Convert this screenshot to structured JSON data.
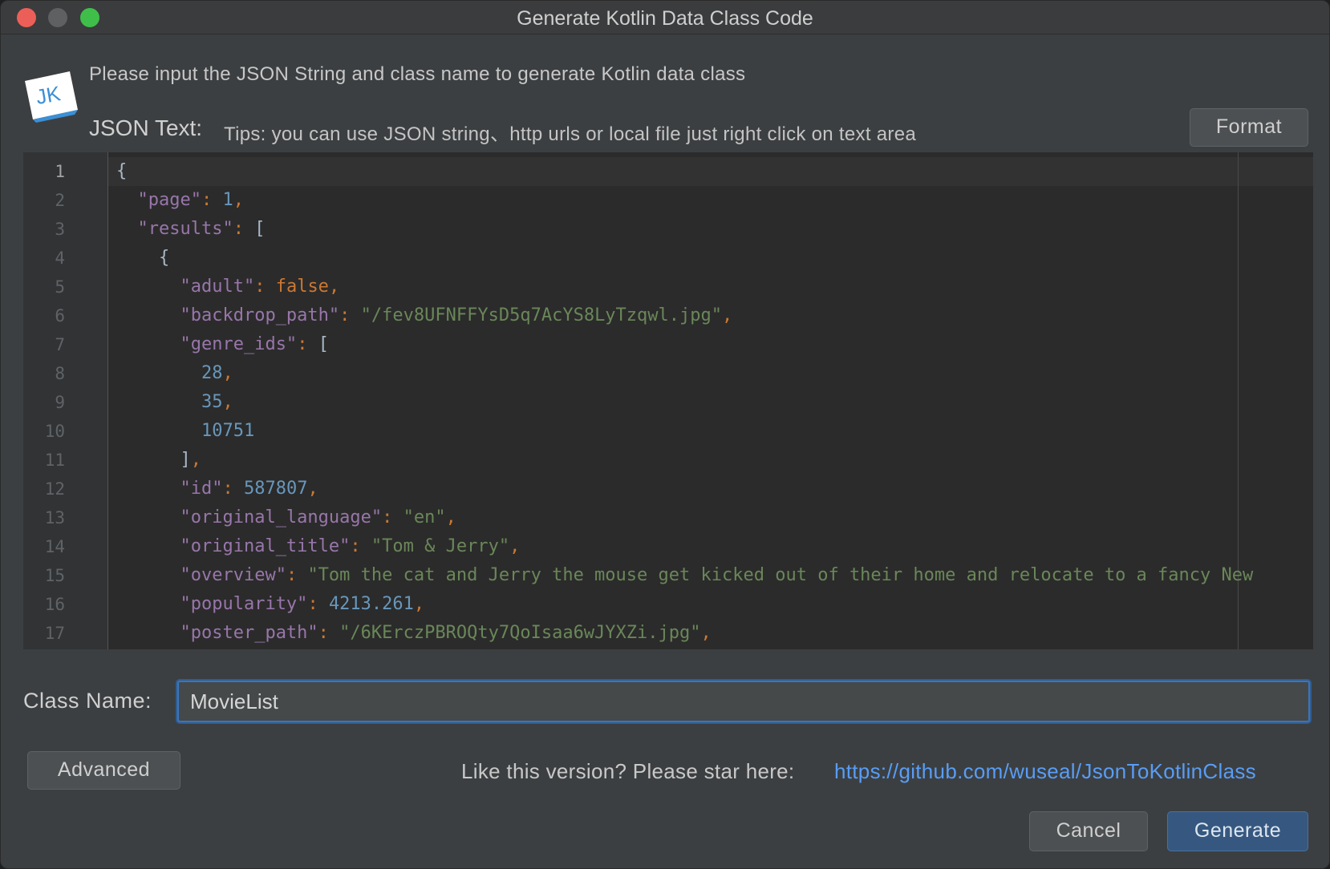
{
  "window": {
    "title": "Generate Kotlin Data Class Code"
  },
  "header": {
    "logo_text": "JK",
    "instruction": "Please input the JSON String and class name to generate Kotlin data class",
    "json_label": "JSON Text:",
    "json_tips": "Tips: you can use JSON string、http urls or local file just right click on text area",
    "format_label": "Format"
  },
  "editor": {
    "current_line": 1,
    "lines": [
      [
        {
          "t": "brace",
          "v": "{"
        }
      ],
      [
        {
          "t": "ws",
          "v": "  "
        },
        {
          "t": "key",
          "v": "\"page\""
        },
        {
          "t": "punct",
          "v": ": "
        },
        {
          "t": "num",
          "v": "1"
        },
        {
          "t": "punct",
          "v": ","
        }
      ],
      [
        {
          "t": "ws",
          "v": "  "
        },
        {
          "t": "key",
          "v": "\"results\""
        },
        {
          "t": "punct",
          "v": ": "
        },
        {
          "t": "brace",
          "v": "["
        }
      ],
      [
        {
          "t": "ws",
          "v": "    "
        },
        {
          "t": "brace",
          "v": "{"
        }
      ],
      [
        {
          "t": "ws",
          "v": "      "
        },
        {
          "t": "key",
          "v": "\"adult\""
        },
        {
          "t": "punct",
          "v": ": "
        },
        {
          "t": "kw",
          "v": "false"
        },
        {
          "t": "punct",
          "v": ","
        }
      ],
      [
        {
          "t": "ws",
          "v": "      "
        },
        {
          "t": "key",
          "v": "\"backdrop_path\""
        },
        {
          "t": "punct",
          "v": ": "
        },
        {
          "t": "str",
          "v": "\"/fev8UFNFFYsD5q7AcYS8LyTzqwl.jpg\""
        },
        {
          "t": "punct",
          "v": ","
        }
      ],
      [
        {
          "t": "ws",
          "v": "      "
        },
        {
          "t": "key",
          "v": "\"genre_ids\""
        },
        {
          "t": "punct",
          "v": ": "
        },
        {
          "t": "brace",
          "v": "["
        }
      ],
      [
        {
          "t": "ws",
          "v": "        "
        },
        {
          "t": "num",
          "v": "28"
        },
        {
          "t": "punct",
          "v": ","
        }
      ],
      [
        {
          "t": "ws",
          "v": "        "
        },
        {
          "t": "num",
          "v": "35"
        },
        {
          "t": "punct",
          "v": ","
        }
      ],
      [
        {
          "t": "ws",
          "v": "        "
        },
        {
          "t": "num",
          "v": "10751"
        }
      ],
      [
        {
          "t": "ws",
          "v": "      "
        },
        {
          "t": "brace",
          "v": "]"
        },
        {
          "t": "punct",
          "v": ","
        }
      ],
      [
        {
          "t": "ws",
          "v": "      "
        },
        {
          "t": "key",
          "v": "\"id\""
        },
        {
          "t": "punct",
          "v": ": "
        },
        {
          "t": "num",
          "v": "587807"
        },
        {
          "t": "punct",
          "v": ","
        }
      ],
      [
        {
          "t": "ws",
          "v": "      "
        },
        {
          "t": "key",
          "v": "\"original_language\""
        },
        {
          "t": "punct",
          "v": ": "
        },
        {
          "t": "str",
          "v": "\"en\""
        },
        {
          "t": "punct",
          "v": ","
        }
      ],
      [
        {
          "t": "ws",
          "v": "      "
        },
        {
          "t": "key",
          "v": "\"original_title\""
        },
        {
          "t": "punct",
          "v": ": "
        },
        {
          "t": "str",
          "v": "\"Tom & Jerry\""
        },
        {
          "t": "punct",
          "v": ","
        }
      ],
      [
        {
          "t": "ws",
          "v": "      "
        },
        {
          "t": "key",
          "v": "\"overview\""
        },
        {
          "t": "punct",
          "v": ": "
        },
        {
          "t": "str",
          "v": "\"Tom the cat and Jerry the mouse get kicked out of their home and relocate to a fancy New"
        }
      ],
      [
        {
          "t": "ws",
          "v": "      "
        },
        {
          "t": "key",
          "v": "\"popularity\""
        },
        {
          "t": "punct",
          "v": ": "
        },
        {
          "t": "num",
          "v": "4213.261"
        },
        {
          "t": "punct",
          "v": ","
        }
      ],
      [
        {
          "t": "ws",
          "v": "      "
        },
        {
          "t": "key",
          "v": "\"poster_path\""
        },
        {
          "t": "punct",
          "v": ": "
        },
        {
          "t": "str",
          "v": "\"/6KErczPBROQty7QoIsaa6wJYXZi.jpg\""
        },
        {
          "t": "punct",
          "v": ","
        }
      ]
    ]
  },
  "form": {
    "class_name_label": "Class Name:",
    "class_name_value": "MovieList"
  },
  "footer": {
    "advanced_label": "Advanced",
    "star_text": "Like this version? Please star here:",
    "star_link": "https://github.com/wuseal/JsonToKotlinClass",
    "cancel_label": "Cancel",
    "generate_label": "Generate"
  },
  "colors": {
    "key": "#9876aa",
    "string": "#6a8759",
    "number": "#6897bb",
    "keyword": "#cc7832",
    "link": "#589df6",
    "primary_button": "#365880"
  }
}
